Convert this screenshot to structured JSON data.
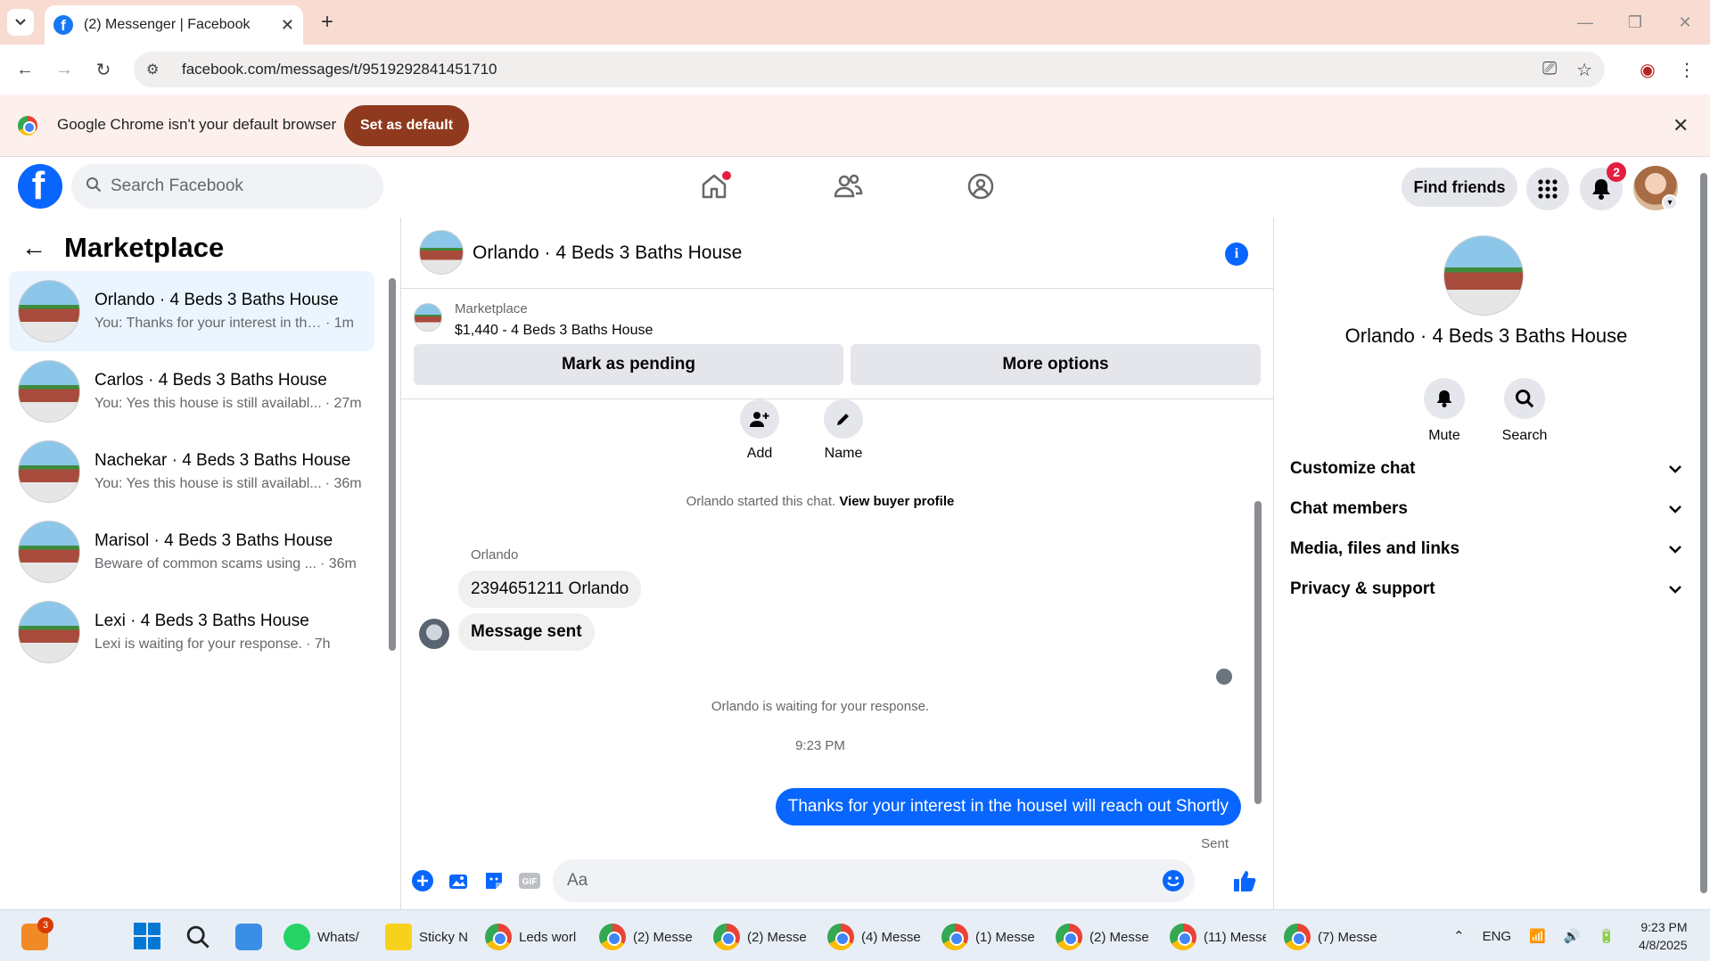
{
  "browser": {
    "tab_title": "(2) Messenger | Facebook",
    "url": "facebook.com/messages/t/9519292841451710",
    "infobar_message": "Google Chrome isn't your default browser",
    "infobar_button": "Set as default"
  },
  "fb": {
    "search_placeholder": "Search Facebook",
    "find_friends": "Find friends",
    "notifications_count": "2"
  },
  "sidebar": {
    "title": "Marketplace",
    "chats": [
      {
        "name": "Orlando · 4 Beds 3 Baths House",
        "preview": "You: Thanks for your interest in the...",
        "time": "· 1m"
      },
      {
        "name": "Carlos · 4 Beds 3 Baths House",
        "preview": "You: Yes this house is still availabl...",
        "time": "· 27m"
      },
      {
        "name": "Nachekar · 4 Beds 3 Baths House",
        "preview": "You: Yes this house is still availabl...",
        "time": "· 36m"
      },
      {
        "name": "Marisol · 4 Beds 3 Baths House",
        "preview": "Beware of common scams using ...",
        "time": "· 36m"
      },
      {
        "name": "Lexi · 4 Beds 3 Baths House",
        "preview": "Lexi is waiting for your response.",
        "time": "· 7h"
      }
    ]
  },
  "conversation": {
    "title": "Orlando · 4 Beds 3 Baths House",
    "marketplace_label": "Marketplace",
    "listing": "$1,440 - 4 Beds 3 Baths House",
    "mark_pending": "Mark as pending",
    "more_options": "More options",
    "add_label": "Add",
    "name_label": "Name",
    "started_text": "Orlando started this chat.",
    "view_profile": "View buyer profile",
    "sender": "Orlando",
    "messages_in": [
      "2394651211 Orlando",
      "Message sent"
    ],
    "waiting_text": "Orlando is waiting for your response.",
    "timestamp": "9:23 PM",
    "message_out": "Thanks for your interest in the houseI will reach out Shortly",
    "sent_label": "Sent",
    "input_placeholder": "Aa"
  },
  "details": {
    "title": "Orlando · 4 Beds 3 Baths House",
    "mute": "Mute",
    "search": "Search",
    "sections": [
      "Customize chat",
      "Chat members",
      "Media, files and links",
      "Privacy & support"
    ]
  },
  "taskbar": {
    "widgets_badge": "3",
    "apps": [
      "Whats/",
      "Sticky N",
      "Leds worl",
      "(2) Messe",
      "(2) Messe",
      "(4) Messe",
      "(1) Messe",
      "(2) Messe",
      "(11) Messe",
      "(7) Messe"
    ],
    "lang": "ENG",
    "time": "9:23 PM",
    "date": "4/8/2025"
  },
  "colors": {
    "fb_blue": "#0866ff",
    "chrome_frame": "#f8dcd2",
    "infobar_button": "#8f3a1e",
    "notification_red": "#e41e3f"
  }
}
